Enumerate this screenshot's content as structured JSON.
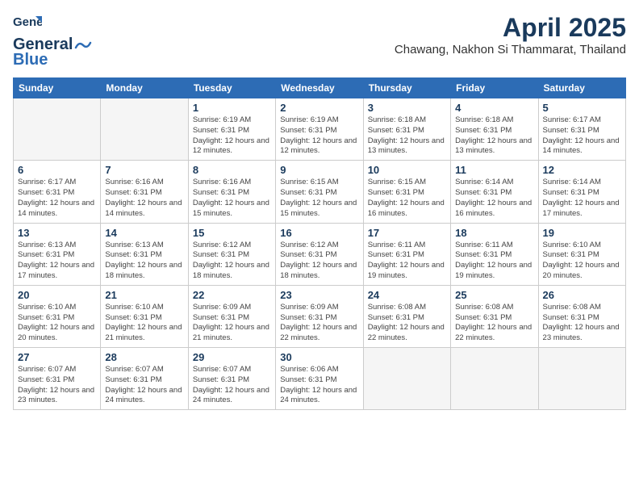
{
  "logo": {
    "general": "General",
    "blue": "Blue"
  },
  "title": "April 2025",
  "location": "Chawang, Nakhon Si Thammarat, Thailand",
  "weekdays": [
    "Sunday",
    "Monday",
    "Tuesday",
    "Wednesday",
    "Thursday",
    "Friday",
    "Saturday"
  ],
  "weeks": [
    [
      {
        "day": "",
        "info": ""
      },
      {
        "day": "",
        "info": ""
      },
      {
        "day": "1",
        "info": "Sunrise: 6:19 AM\nSunset: 6:31 PM\nDaylight: 12 hours and 12 minutes."
      },
      {
        "day": "2",
        "info": "Sunrise: 6:19 AM\nSunset: 6:31 PM\nDaylight: 12 hours and 12 minutes."
      },
      {
        "day": "3",
        "info": "Sunrise: 6:18 AM\nSunset: 6:31 PM\nDaylight: 12 hours and 13 minutes."
      },
      {
        "day": "4",
        "info": "Sunrise: 6:18 AM\nSunset: 6:31 PM\nDaylight: 12 hours and 13 minutes."
      },
      {
        "day": "5",
        "info": "Sunrise: 6:17 AM\nSunset: 6:31 PM\nDaylight: 12 hours and 14 minutes."
      }
    ],
    [
      {
        "day": "6",
        "info": "Sunrise: 6:17 AM\nSunset: 6:31 PM\nDaylight: 12 hours and 14 minutes."
      },
      {
        "day": "7",
        "info": "Sunrise: 6:16 AM\nSunset: 6:31 PM\nDaylight: 12 hours and 14 minutes."
      },
      {
        "day": "8",
        "info": "Sunrise: 6:16 AM\nSunset: 6:31 PM\nDaylight: 12 hours and 15 minutes."
      },
      {
        "day": "9",
        "info": "Sunrise: 6:15 AM\nSunset: 6:31 PM\nDaylight: 12 hours and 15 minutes."
      },
      {
        "day": "10",
        "info": "Sunrise: 6:15 AM\nSunset: 6:31 PM\nDaylight: 12 hours and 16 minutes."
      },
      {
        "day": "11",
        "info": "Sunrise: 6:14 AM\nSunset: 6:31 PM\nDaylight: 12 hours and 16 minutes."
      },
      {
        "day": "12",
        "info": "Sunrise: 6:14 AM\nSunset: 6:31 PM\nDaylight: 12 hours and 17 minutes."
      }
    ],
    [
      {
        "day": "13",
        "info": "Sunrise: 6:13 AM\nSunset: 6:31 PM\nDaylight: 12 hours and 17 minutes."
      },
      {
        "day": "14",
        "info": "Sunrise: 6:13 AM\nSunset: 6:31 PM\nDaylight: 12 hours and 18 minutes."
      },
      {
        "day": "15",
        "info": "Sunrise: 6:12 AM\nSunset: 6:31 PM\nDaylight: 12 hours and 18 minutes."
      },
      {
        "day": "16",
        "info": "Sunrise: 6:12 AM\nSunset: 6:31 PM\nDaylight: 12 hours and 18 minutes."
      },
      {
        "day": "17",
        "info": "Sunrise: 6:11 AM\nSunset: 6:31 PM\nDaylight: 12 hours and 19 minutes."
      },
      {
        "day": "18",
        "info": "Sunrise: 6:11 AM\nSunset: 6:31 PM\nDaylight: 12 hours and 19 minutes."
      },
      {
        "day": "19",
        "info": "Sunrise: 6:10 AM\nSunset: 6:31 PM\nDaylight: 12 hours and 20 minutes."
      }
    ],
    [
      {
        "day": "20",
        "info": "Sunrise: 6:10 AM\nSunset: 6:31 PM\nDaylight: 12 hours and 20 minutes."
      },
      {
        "day": "21",
        "info": "Sunrise: 6:10 AM\nSunset: 6:31 PM\nDaylight: 12 hours and 21 minutes."
      },
      {
        "day": "22",
        "info": "Sunrise: 6:09 AM\nSunset: 6:31 PM\nDaylight: 12 hours and 21 minutes."
      },
      {
        "day": "23",
        "info": "Sunrise: 6:09 AM\nSunset: 6:31 PM\nDaylight: 12 hours and 22 minutes."
      },
      {
        "day": "24",
        "info": "Sunrise: 6:08 AM\nSunset: 6:31 PM\nDaylight: 12 hours and 22 minutes."
      },
      {
        "day": "25",
        "info": "Sunrise: 6:08 AM\nSunset: 6:31 PM\nDaylight: 12 hours and 22 minutes."
      },
      {
        "day": "26",
        "info": "Sunrise: 6:08 AM\nSunset: 6:31 PM\nDaylight: 12 hours and 23 minutes."
      }
    ],
    [
      {
        "day": "27",
        "info": "Sunrise: 6:07 AM\nSunset: 6:31 PM\nDaylight: 12 hours and 23 minutes."
      },
      {
        "day": "28",
        "info": "Sunrise: 6:07 AM\nSunset: 6:31 PM\nDaylight: 12 hours and 24 minutes."
      },
      {
        "day": "29",
        "info": "Sunrise: 6:07 AM\nSunset: 6:31 PM\nDaylight: 12 hours and 24 minutes."
      },
      {
        "day": "30",
        "info": "Sunrise: 6:06 AM\nSunset: 6:31 PM\nDaylight: 12 hours and 24 minutes."
      },
      {
        "day": "",
        "info": ""
      },
      {
        "day": "",
        "info": ""
      },
      {
        "day": "",
        "info": ""
      }
    ]
  ]
}
